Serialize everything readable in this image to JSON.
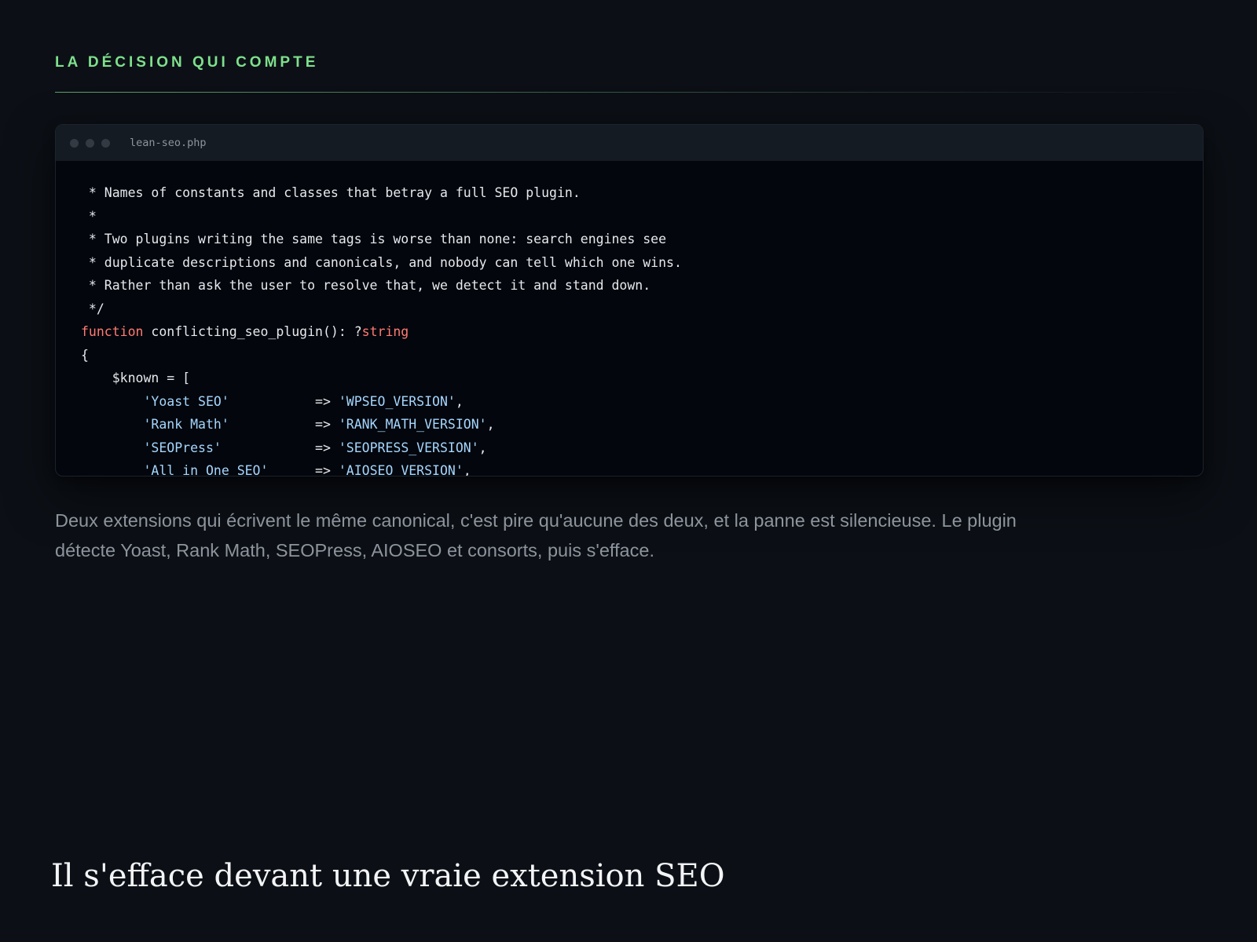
{
  "section": {
    "eyebrow": "LA DÉCISION QUI COMPTE"
  },
  "code_window": {
    "filename": "lean-seo.php",
    "lines": [
      [
        {
          "t": " * Names of constants and classes that betray a full SEO plugin.",
          "k": "plain"
        }
      ],
      [
        {
          "t": " *",
          "k": "plain"
        }
      ],
      [
        {
          "t": " * Two plugins writing the same tags is worse than none: search engines see",
          "k": "plain"
        }
      ],
      [
        {
          "t": " * duplicate descriptions and canonicals, and nobody can tell which one wins.",
          "k": "plain"
        }
      ],
      [
        {
          "t": " * Rather than ask the user to resolve that, we detect it and stand down.",
          "k": "plain"
        }
      ],
      [
        {
          "t": " */",
          "k": "plain"
        }
      ],
      [
        {
          "t": "function",
          "k": "kw"
        },
        {
          "t": " conflicting_seo_plugin(): ?",
          "k": "plain"
        },
        {
          "t": "string",
          "k": "kw"
        }
      ],
      [
        {
          "t": "{",
          "k": "plain"
        }
      ],
      [
        {
          "t": "    $known = [",
          "k": "plain"
        }
      ],
      [
        {
          "t": "        ",
          "k": "plain"
        },
        {
          "t": "'Yoast SEO'",
          "k": "str"
        },
        {
          "t": "           => ",
          "k": "plain"
        },
        {
          "t": "'WPSEO_VERSION'",
          "k": "str"
        },
        {
          "t": ",",
          "k": "plain"
        }
      ],
      [
        {
          "t": "        ",
          "k": "plain"
        },
        {
          "t": "'Rank Math'",
          "k": "str"
        },
        {
          "t": "           => ",
          "k": "plain"
        },
        {
          "t": "'RANK_MATH_VERSION'",
          "k": "str"
        },
        {
          "t": ",",
          "k": "plain"
        }
      ],
      [
        {
          "t": "        ",
          "k": "plain"
        },
        {
          "t": "'SEOPress'",
          "k": "str"
        },
        {
          "t": "            => ",
          "k": "plain"
        },
        {
          "t": "'SEOPRESS_VERSION'",
          "k": "str"
        },
        {
          "t": ",",
          "k": "plain"
        }
      ],
      [
        {
          "t": "        ",
          "k": "plain"
        },
        {
          "t": "'All in One SEO'",
          "k": "str"
        },
        {
          "t": "      => ",
          "k": "plain"
        },
        {
          "t": "'AIOSEO_VERSION'",
          "k": "str"
        },
        {
          "t": ",",
          "k": "plain"
        }
      ]
    ]
  },
  "description": "Deux extensions qui écrivent le même canonical, c'est pire qu'aucune des deux, et la panne est silencieuse. Le plugin détecte Yoast, Rank Math, SEOPress, AIOSEO et consorts, puis s'efface.",
  "next_section": {
    "heading": "Il s'efface devant une vraie extension SEO"
  },
  "colors": {
    "background": "#0c1016",
    "accent": "#7ee08c",
    "keyword": "#ff7b72",
    "string": "#a5d6ff"
  }
}
